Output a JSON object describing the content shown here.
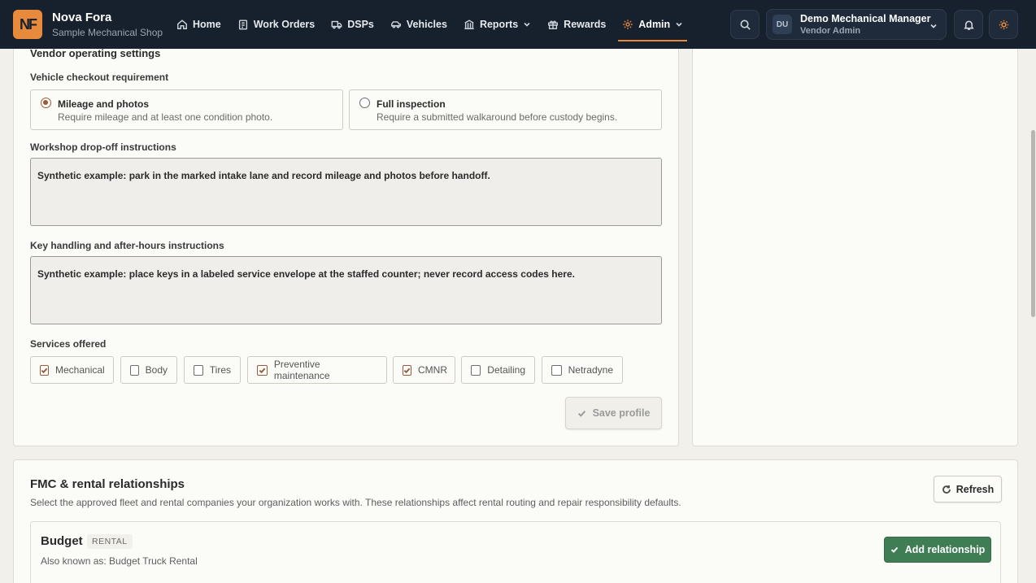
{
  "brand": {
    "logo_text": "NF",
    "name": "Nova Fora",
    "shop": "Sample Mechanical Shop",
    "accent": "#e88a3b"
  },
  "nav": {
    "items": [
      {
        "label": "Home",
        "icon": "home-icon"
      },
      {
        "label": "Work Orders",
        "icon": "clipboard-icon"
      },
      {
        "label": "DSPs",
        "icon": "truck-icon"
      },
      {
        "label": "Vehicles",
        "icon": "car-icon"
      },
      {
        "label": "Reports",
        "icon": "bank-icon",
        "dropdown": true
      },
      {
        "label": "Rewards",
        "icon": "gift-icon"
      },
      {
        "label": "Admin",
        "icon": "gear-icon",
        "dropdown": true,
        "active": true
      }
    ]
  },
  "user": {
    "initials": "DU",
    "name": "Demo Mechanical Manager",
    "role": "Vendor Admin"
  },
  "settings": {
    "title": "Vendor operating settings",
    "checkout_label": "Vehicle checkout requirement",
    "options": [
      {
        "title": "Mileage and photos",
        "desc": "Require mileage and at least one condition photo.",
        "selected": true
      },
      {
        "title": "Full inspection",
        "desc": "Require a submitted walkaround before custody begins.",
        "selected": false
      }
    ],
    "dropoff_label": "Workshop drop-off instructions",
    "dropoff_value": "Synthetic example: park in the marked intake lane and record mileage and photos before handoff.",
    "keys_label": "Key handling and after-hours instructions",
    "keys_value": "Synthetic example: place keys in a labeled service envelope at the staffed counter; never record access codes here.",
    "services_label": "Services offered",
    "services": [
      {
        "label": "Mechanical",
        "checked": true
      },
      {
        "label": "Body",
        "checked": false
      },
      {
        "label": "Tires",
        "checked": false
      },
      {
        "label": "Preventive maintenance",
        "checked": true
      },
      {
        "label": "CMNR",
        "checked": true
      },
      {
        "label": "Detailing",
        "checked": false
      },
      {
        "label": "Netradyne",
        "checked": false
      }
    ],
    "save_label": "Save profile"
  },
  "fmc": {
    "title": "FMC & rental relationships",
    "description": "Select the approved fleet and rental companies your organization works with. These relationships affect rental routing and repair responsibility defaults.",
    "refresh_label": "Refresh",
    "relationship": {
      "name": "Budget",
      "badge": "RENTAL",
      "aka": "Also known as: Budget Truck Rental",
      "add_label": "Add relationship"
    }
  },
  "colors": {
    "topbar": "#17212e",
    "success": "#3f7d55",
    "check": "#9a5a35"
  }
}
